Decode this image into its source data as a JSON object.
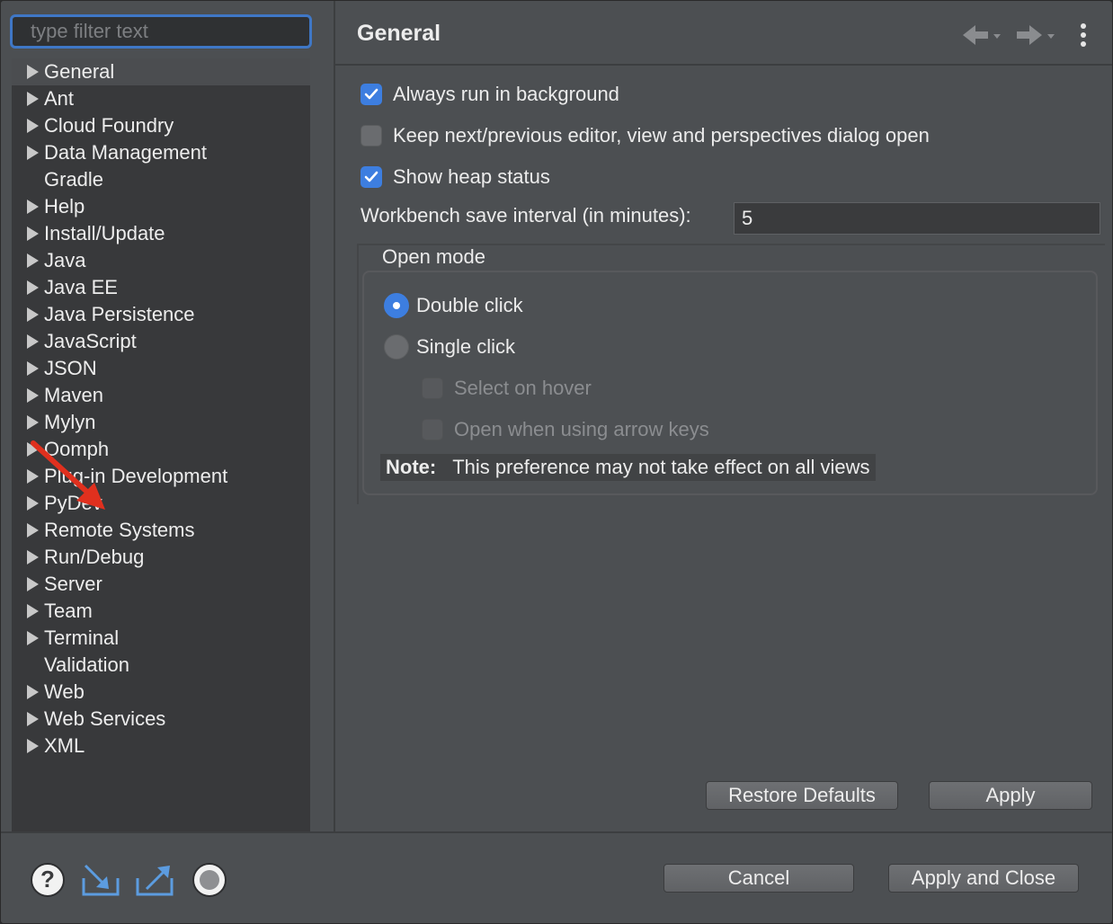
{
  "sidebar": {
    "filter_placeholder": "type filter text",
    "items": [
      {
        "label": "General",
        "expandable": true,
        "selected": true
      },
      {
        "label": "Ant",
        "expandable": true
      },
      {
        "label": "Cloud Foundry",
        "expandable": true
      },
      {
        "label": "Data Management",
        "expandable": true
      },
      {
        "label": "Gradle",
        "expandable": false
      },
      {
        "label": "Help",
        "expandable": true
      },
      {
        "label": "Install/Update",
        "expandable": true
      },
      {
        "label": "Java",
        "expandable": true
      },
      {
        "label": "Java EE",
        "expandable": true
      },
      {
        "label": "Java Persistence",
        "expandable": true
      },
      {
        "label": "JavaScript",
        "expandable": true
      },
      {
        "label": "JSON",
        "expandable": true
      },
      {
        "label": "Maven",
        "expandable": true
      },
      {
        "label": "Mylyn",
        "expandable": true
      },
      {
        "label": "Oomph",
        "expandable": true
      },
      {
        "label": "Plug-in Development",
        "expandable": true
      },
      {
        "label": "PyDev",
        "expandable": true
      },
      {
        "label": "Remote Systems",
        "expandable": true
      },
      {
        "label": "Run/Debug",
        "expandable": true
      },
      {
        "label": "Server",
        "expandable": true
      },
      {
        "label": "Team",
        "expandable": true
      },
      {
        "label": "Terminal",
        "expandable": true
      },
      {
        "label": "Validation",
        "expandable": false
      },
      {
        "label": "Web",
        "expandable": true
      },
      {
        "label": "Web Services",
        "expandable": true
      },
      {
        "label": "XML",
        "expandable": true
      }
    ]
  },
  "header": {
    "title": "General",
    "back_icon": "arrow-left-icon",
    "forward_icon": "arrow-right-icon",
    "menu_icon": "more-vertical-icon"
  },
  "settings": {
    "always_run_background": {
      "label": "Always run in background",
      "checked": true
    },
    "keep_dialog_open": {
      "label": "Keep next/previous editor, view and perspectives dialog open",
      "checked": false
    },
    "show_heap_status": {
      "label": "Show heap status",
      "checked": true
    },
    "save_interval": {
      "label": "Workbench save interval (in minutes):",
      "value": "5"
    }
  },
  "open_mode": {
    "title": "Open mode",
    "double_click": {
      "label": "Double click",
      "selected": true
    },
    "single_click": {
      "label": "Single click",
      "selected": false
    },
    "select_on_hover": {
      "label": "Select on hover",
      "checked": false,
      "enabled": false
    },
    "open_arrow_keys": {
      "label": "Open when using arrow keys",
      "checked": false,
      "enabled": false
    },
    "note_label": "Note:",
    "note_text": "This preference may not take effect on all views"
  },
  "buttons": {
    "restore_defaults": "Restore Defaults",
    "apply": "Apply",
    "cancel": "Cancel",
    "apply_and_close": "Apply and Close"
  },
  "footer_icons": [
    "help-icon",
    "import-icon",
    "export-icon",
    "record-icon"
  ],
  "colors": {
    "accent": "#3d7ee0",
    "annotation_arrow": "#e0301e",
    "background": "#4c4f52",
    "tree_background": "#38393b"
  }
}
